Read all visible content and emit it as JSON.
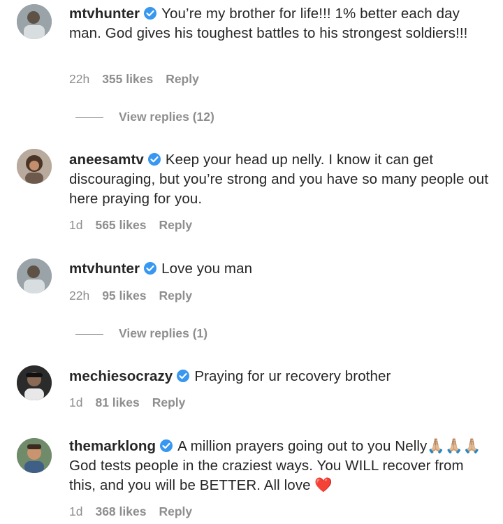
{
  "comments": [
    {
      "username": "mtvhunter",
      "text": "You’re my brother for life!!! 1% better each day man. God gives his toughest battles to his strongest soldiers!!!",
      "time": "22h",
      "likes": "355 likes",
      "reply": "Reply",
      "view_replies": "View replies (12)"
    },
    {
      "username": "aneesamtv",
      "text": "Keep your head up nelly. I know it can get discouraging, but you’re strong and you have so many people out here praying for you.",
      "time": "1d",
      "likes": "565 likes",
      "reply": "Reply"
    },
    {
      "username": "mtvhunter",
      "text": "Love you man",
      "time": "22h",
      "likes": "95 likes",
      "reply": "Reply",
      "view_replies": "View replies (1)"
    },
    {
      "username": "mechiesocrazy",
      "text": "Praying for ur recovery brother",
      "time": "1d",
      "likes": "81 likes",
      "reply": "Reply"
    },
    {
      "username": "themarklong",
      "text": "A million prayers going out to you Nelly🙏🏼🙏🏼🙏🏼 God tests people in the craziest ways. You WILL recover from this, and you will be BETTER. All love",
      "heart": "❤️",
      "time": "1d",
      "likes": "368 likes",
      "reply": "Reply"
    }
  ],
  "colors": {
    "verified": "#3897f0",
    "secondary_text": "#8e8e8e",
    "text": "#262626"
  }
}
